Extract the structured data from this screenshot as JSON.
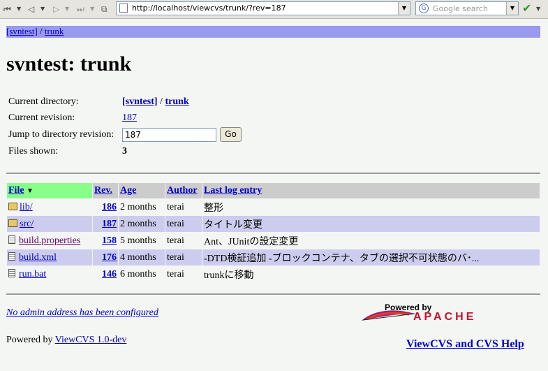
{
  "browser": {
    "url": "http://localhost/viewcvs/trunk/?rev=187",
    "search_placeholder": "Google search"
  },
  "breadcrumb": {
    "root": "[svntest]",
    "sep": " / ",
    "current": "trunk"
  },
  "title": "svntest: trunk",
  "info": {
    "current_directory_label": "Current directory:",
    "current_directory_root": "[svntest]",
    "current_directory_sep": " / ",
    "current_directory_leaf": "trunk",
    "current_revision_label": "Current revision:",
    "current_revision": "187",
    "jump_label": "Jump to directory revision:",
    "jump_value": "187",
    "go_label": "Go",
    "files_shown_label": "Files shown:",
    "files_shown": "3"
  },
  "table": {
    "headers": {
      "file": "File",
      "sort_arrow": "▼",
      "rev": "Rev.",
      "age": "Age",
      "author": "Author",
      "log": "Last log entry"
    },
    "rows": [
      {
        "name": "lib/",
        "rev": "186",
        "age": "2 months",
        "author": "terai",
        "log": "整形",
        "type": "dir"
      },
      {
        "name": "src/",
        "rev": "187",
        "age": "2 months",
        "author": "terai",
        "log": "タイトル変更",
        "type": "dir"
      },
      {
        "name": "build.properties",
        "rev": "158",
        "age": "5 months",
        "author": "terai",
        "log": "Ant、JUnitの設定変更",
        "type": "file"
      },
      {
        "name": "build.xml",
        "rev": "176",
        "age": "4 months",
        "author": "terai",
        "log": "-DTD検証追加 -ブロックコンテナ、タブの選択不可状態のバ･...",
        "type": "file"
      },
      {
        "name": "run.bat",
        "rev": "146",
        "age": "6 months",
        "author": "terai",
        "log": "trunkに移動",
        "type": "file"
      }
    ]
  },
  "footer": {
    "admin": "No admin address has been configured",
    "powered_prefix": "Powered by ",
    "powered_link": "ViewCVS 1.0-dev",
    "help": "ViewCVS and CVS Help",
    "apache_top": "Powered by",
    "apache_word": "APACHE"
  }
}
